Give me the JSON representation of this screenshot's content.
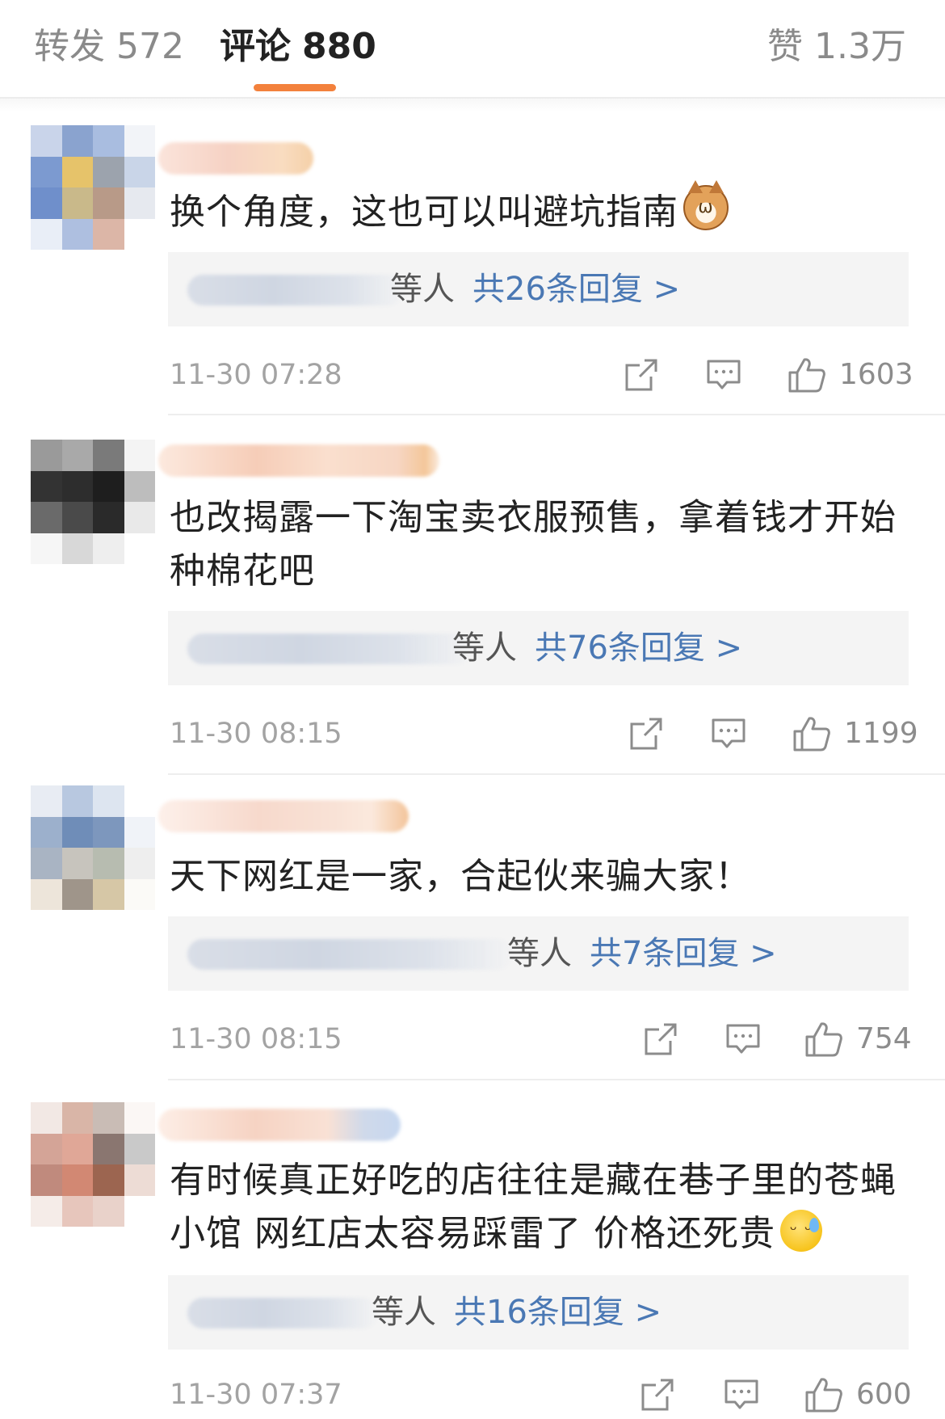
{
  "tabs": {
    "forward_label": "转发",
    "forward_count": "572",
    "comment_label": "评论",
    "comment_count": "880",
    "like_label": "赞",
    "like_count": "1.3万",
    "active_color": "#f3813c"
  },
  "reply_link_color": "#4a78b4",
  "icons": {
    "share": "share-icon",
    "reply": "comment-icon",
    "like": "thumbs-up-icon"
  },
  "comments": [
    {
      "text": "换个角度，这也可以叫避坑指南",
      "emoji": "cat-emoji",
      "reply_others": "等人",
      "reply_summary": "共26条回复 >",
      "time": "11-30 07:28",
      "likes": "1603"
    },
    {
      "text": "也改揭露一下淘宝卖衣服预售，拿着钱才开始种棉花吧",
      "emoji": "",
      "reply_others": "等人",
      "reply_summary": "共76条回复 >",
      "time": "11-30 08:15",
      "likes": "1199"
    },
    {
      "text": "天下网红是一家，合起伙来骗大家！",
      "emoji": "",
      "reply_others": "等人",
      "reply_summary": "共7条回复 >",
      "time": "11-30 08:15",
      "likes": "754"
    },
    {
      "text": "有时候真正好吃的店往往是藏在巷子里的苍蝇小馆 网红店太容易踩雷了 价格还死贵",
      "emoji": "sweat-emoji",
      "reply_others": "等人",
      "reply_summary": "共16条回复 >",
      "time": "11-30 07:37",
      "likes": "600"
    }
  ]
}
